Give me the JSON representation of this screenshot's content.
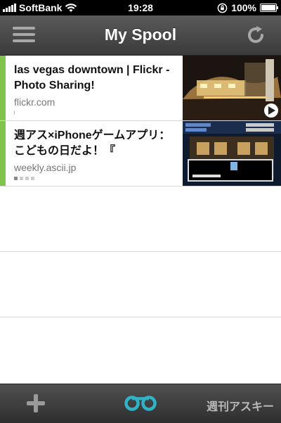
{
  "status_bar": {
    "carrier": "SoftBank",
    "time": "19:28",
    "battery": "100%"
  },
  "nav": {
    "title": "My Spool",
    "menu_icon": "hamburger-menu-icon",
    "refresh_icon": "refresh-icon"
  },
  "items": [
    {
      "title": "las vegas downtown | Flickr - Photo Sharing!",
      "domain": "flickr.com"
    },
    {
      "title": "週アス×iPhoneゲームアプリ：こどもの日だよ！『",
      "domain": "weekly.ascii.jp"
    }
  ],
  "toolbar": {
    "add_icon": "plus-icon",
    "spool_icon": "spool-icon",
    "watermark": "週刊アスキー"
  },
  "colors": {
    "accent_bar": "#80c44b",
    "spool_icon": "#2fb3c7"
  }
}
